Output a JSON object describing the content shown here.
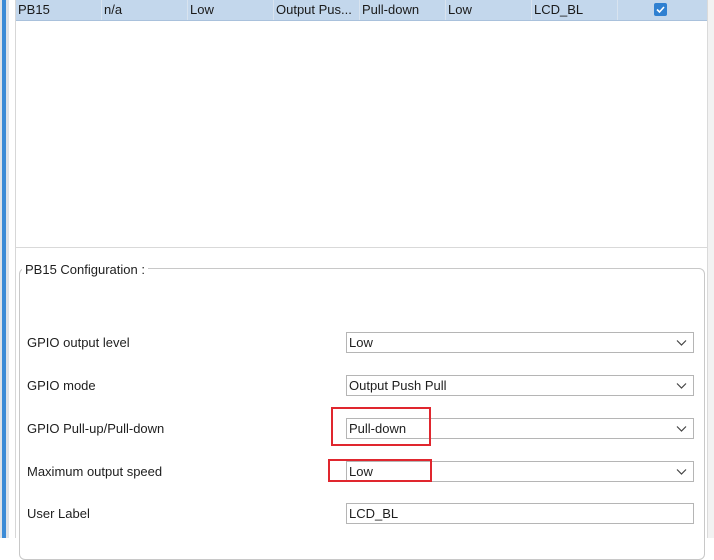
{
  "pin_row": {
    "pin": "PB15",
    "signal": "n/a",
    "output_level": "Low",
    "mode": "Output Pus...",
    "pull": "Pull-down",
    "speed": "Low",
    "user_label": "LCD_BL",
    "modified": true
  },
  "config": {
    "title": "PB15 Configuration :",
    "fields": [
      {
        "label": "GPIO output level",
        "value": "Low"
      },
      {
        "label": "GPIO mode",
        "value": "Output Push Pull"
      },
      {
        "label": "GPIO Pull-up/Pull-down",
        "value": "Pull-down"
      },
      {
        "label": "Maximum output speed",
        "value": "Low"
      },
      {
        "label": "User Label",
        "value": "LCD_BL"
      }
    ]
  },
  "colors": {
    "row_selected": "#c3d7ec",
    "highlight": "#e0262e",
    "checkbox": "#2f80d1"
  }
}
